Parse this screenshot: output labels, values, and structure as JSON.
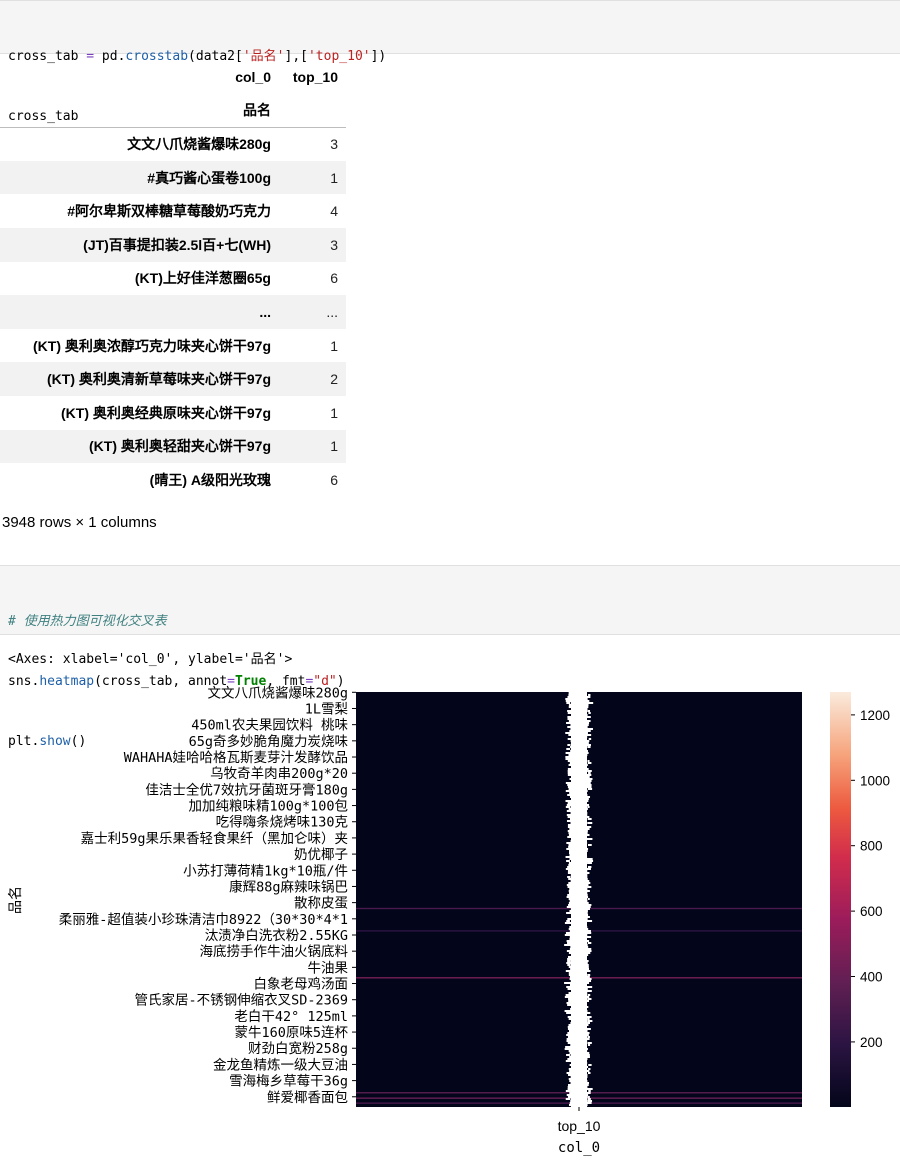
{
  "cell1": {
    "line1_a": "cross_tab ",
    "line1_eq": "=",
    "line1_b": " pd.",
    "line1_fn": "crosstab",
    "line1_c": "(data2[",
    "line1_str1": "'品名'",
    "line1_d": "],[",
    "line1_str2": "'top_10'",
    "line1_e": "])",
    "line2": "cross_tab"
  },
  "table": {
    "col_header": "col_0",
    "col_name": "top_10",
    "index_name": "品名",
    "rows": [
      {
        "label": "文文八爪烧酱爆味280g",
        "value": "3"
      },
      {
        "label": "#真巧酱心蛋卷100g",
        "value": "1"
      },
      {
        "label": "#阿尔卑斯双棒糖草莓酸奶巧克力",
        "value": "4"
      },
      {
        "label": "(JT)百事提扣装2.5l百+七(WH)",
        "value": "3"
      },
      {
        "label": "(KT)上好佳洋葱圈65g",
        "value": "6"
      },
      {
        "label": "...",
        "value": "..."
      },
      {
        "label": "(KT) 奥利奥浓醇巧克力味夹心饼干97g",
        "value": "1"
      },
      {
        "label": "(KT) 奥利奥清新草莓味夹心饼干97g",
        "value": "2"
      },
      {
        "label": "(KT) 奥利奥经典原味夹心饼干97g",
        "value": "1"
      },
      {
        "label": "(KT) 奥利奥轻甜夹心饼干97g",
        "value": "1"
      },
      {
        "label": "(晴王) A级阳光玫瑰",
        "value": "6"
      }
    ],
    "shape_note": "3948 rows × 1 columns"
  },
  "cell2": {
    "comment": "# 使用热力图可视化交叉表",
    "l2_a": "sns.",
    "l2_fn": "heatmap",
    "l2_b": "(cross_tab, annot",
    "l2_eq": "=",
    "l2_kw": "True",
    "l2_c": ", fmt",
    "l2_eq2": "=",
    "l2_str": "\"d\"",
    "l2_d": ")",
    "l3_a": "plt.",
    "l3_fn": "show",
    "l3_b": "()"
  },
  "output_repr": "<Axes: xlabel='col_0', ylabel='品名'>",
  "chart_data": {
    "type": "heatmap",
    "xlabel": "col_0",
    "ylabel": "品名",
    "x_tick_labels": [
      "top_10"
    ],
    "y_tick_labels": [
      "文文八爪烧酱爆味280g",
      "1L雪梨",
      "450ml农夫果园饮料 桃味",
      "65g奇多妙脆角魔力炭烧味",
      "WAHAHA娃哈哈格瓦斯麦芽汁发酵饮品",
      "乌牧奇羊肉串200g*20",
      "佳洁士全优7效抗牙菌斑牙膏180g",
      "加加纯粮味精100g*100包",
      "吃得嗨条烧烤味130克",
      "嘉士利59g果乐果香轻食果纤（黑加仑味）夹",
      "奶优椰子",
      "小苏打薄荷精1kg*10瓶/件",
      "康辉88g麻辣味锅巴",
      "散称皮蛋",
      "柔丽雅-超值装小珍珠清洁巾8922（30*30*4*1",
      "汰渍净白洗衣粉2.55KG",
      "海底捞手作牛油火锅底料",
      "牛油果",
      "白象老母鸡汤面",
      "管氏家居-不锈钢伸缩衣叉SD-2369",
      "老白干42° 125ml",
      "蒙牛160原味5连杯",
      "财劲白宽粉258g",
      "金龙鱼精炼一级大豆油",
      "雪海梅乡草莓干36g",
      "鲜爱椰香面包"
    ],
    "colorbar_ticks": [
      200,
      400,
      600,
      800,
      1000,
      1200
    ],
    "vmin": 1,
    "vmax": 1270,
    "n_rows": 3948,
    "highlight_rows": [
      {
        "position": 0.52,
        "value": 300
      },
      {
        "position": 0.574,
        "value": 200
      },
      {
        "position": 0.687,
        "value": 450
      },
      {
        "position": 0.964,
        "value": 350
      },
      {
        "position": 0.977,
        "value": 400
      },
      {
        "position": 0.989,
        "value": 300
      }
    ],
    "annot_example": "1"
  }
}
